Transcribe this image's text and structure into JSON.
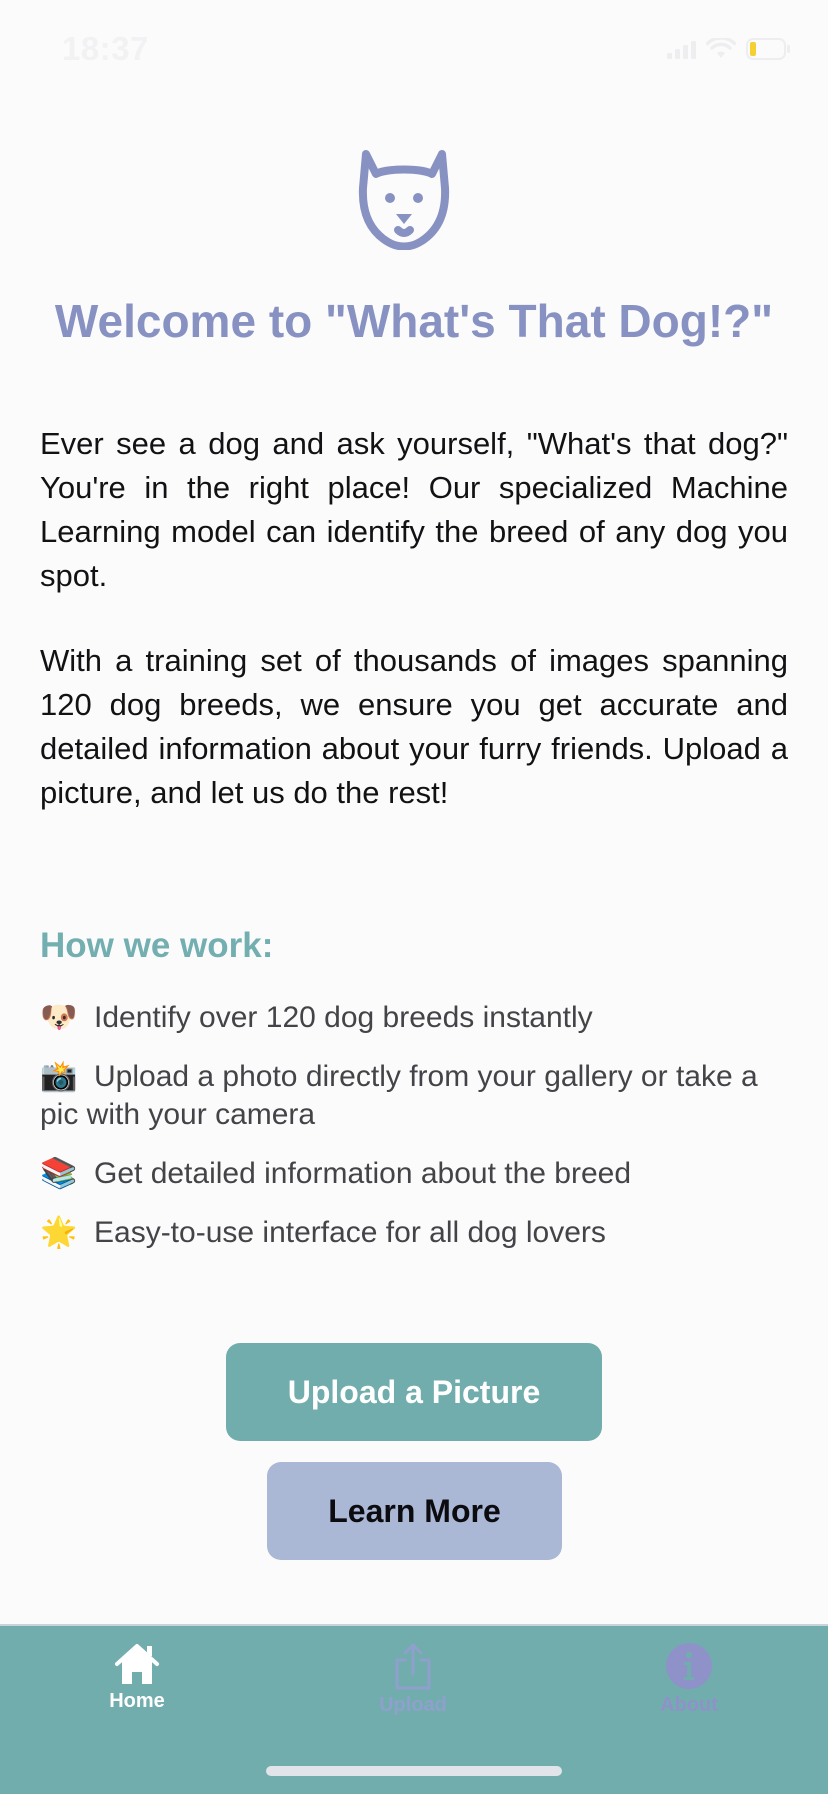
{
  "status_bar": {
    "time": "18:37"
  },
  "hero": {
    "logo_icon": "dog-face-icon",
    "title": "Welcome to \"What's That Dog!?\"",
    "paragraphs": [
      "Ever see a dog and ask yourself, \"What's that dog?\" You're in the right place! Our specialized Machine Learning model can identify the breed of any dog you spot.",
      "With a training set of thousands of images spanning 120 dog breeds, we ensure you get accurate and detailed information about your furry friends. Upload a picture, and let us do the rest!"
    ]
  },
  "how": {
    "title": "How we work:",
    "features": [
      {
        "emoji": "🐶",
        "text": "Identify over 120 dog breeds instantly"
      },
      {
        "emoji": "📸",
        "text": "Upload a photo directly from your gallery or take a pic with your camera"
      },
      {
        "emoji": "📚",
        "text": "Get detailed information about the breed"
      },
      {
        "emoji": "🌟",
        "text": "Easy-to-use interface for all dog lovers"
      }
    ]
  },
  "buttons": {
    "upload": "Upload a Picture",
    "learn_more": "Learn More"
  },
  "tab_bar": {
    "active": "home",
    "tabs": [
      {
        "id": "home",
        "label": "Home",
        "icon": "house-icon"
      },
      {
        "id": "upload",
        "label": "Upload",
        "icon": "share-upload-icon"
      },
      {
        "id": "about",
        "label": "About",
        "icon": "info-icon"
      }
    ]
  },
  "colors": {
    "title": "#8892c2",
    "accent_teal": "#72adae",
    "accent_lavender": "#aab7d5"
  }
}
